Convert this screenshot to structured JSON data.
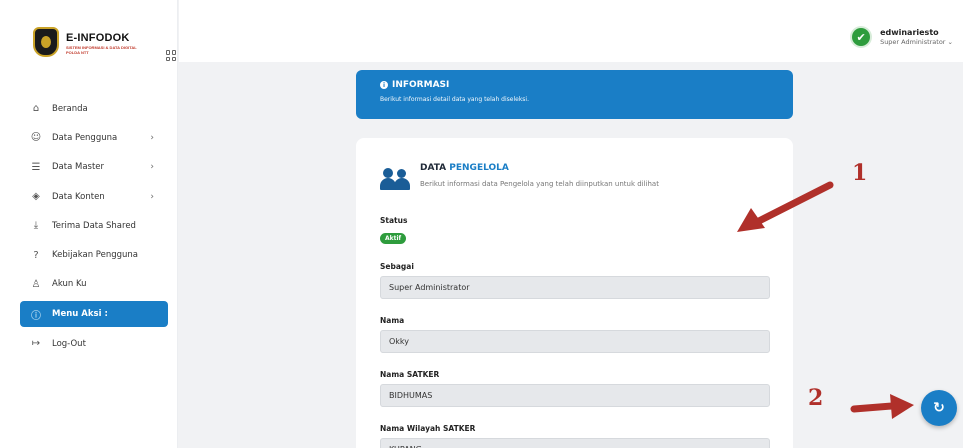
{
  "brand": {
    "title": "E-INFODOK",
    "subtitle": "SISTEM INFORMASI & DATA DIGITAL POLDA NTT"
  },
  "sidebar": {
    "items": [
      {
        "label": "Beranda",
        "icon": "home-icon",
        "glyph": "⌂",
        "chevron": false
      },
      {
        "label": "Data Pengguna",
        "icon": "users-icon",
        "glyph": "☺",
        "chevron": true
      },
      {
        "label": "Data Master",
        "icon": "database-icon",
        "glyph": "☰",
        "chevron": true
      },
      {
        "label": "Data Konten",
        "icon": "layers-icon",
        "glyph": "◈",
        "chevron": true
      },
      {
        "label": "Terima Data Shared",
        "icon": "download-icon",
        "glyph": "⤓",
        "chevron": false
      },
      {
        "label": "Kebijakan Pengguna",
        "icon": "help-icon",
        "glyph": "?",
        "chevron": false
      },
      {
        "label": "Akun Ku",
        "icon": "user-icon",
        "glyph": "♙",
        "chevron": false
      },
      {
        "label": "Menu Aksi :",
        "icon": "info-circle-icon",
        "glyph": "ⓘ",
        "chevron": false,
        "active": true
      },
      {
        "label": "Log-Out",
        "icon": "logout-icon",
        "glyph": "↦",
        "chevron": false
      }
    ],
    "chevron_glyph": "›"
  },
  "topbar": {
    "user_name": "edwinariesto",
    "user_role": "Super Administrator ⌄",
    "check_glyph": "✔"
  },
  "info": {
    "title": "INFORMASI",
    "subtitle": "Berikut informasi detail data yang telah diseleksi.",
    "icon_glyph": "i"
  },
  "card": {
    "title_main": "DATA ",
    "title_accent": "PENGELOLA",
    "subtitle": "Berikut informasi data Pengelola yang telah diinputkan untuk dilihat",
    "status_label": "Status",
    "status_badge": "Aktif",
    "fields": [
      {
        "label": "Sebagai",
        "value": "Super Administrator"
      },
      {
        "label": "Nama",
        "value": "Okky"
      },
      {
        "label": "Nama SATKER",
        "value": "BIDHUMAS"
      },
      {
        "label": "Nama Wilayah SATKER",
        "value": "KUPANG"
      }
    ]
  },
  "annotations": {
    "num1": "1",
    "num2": "2",
    "arrow_color": "#b0302a"
  },
  "fab": {
    "glyph": "↻"
  },
  "colors": {
    "primary": "#1a7ec6",
    "success": "#2e9c3d"
  }
}
